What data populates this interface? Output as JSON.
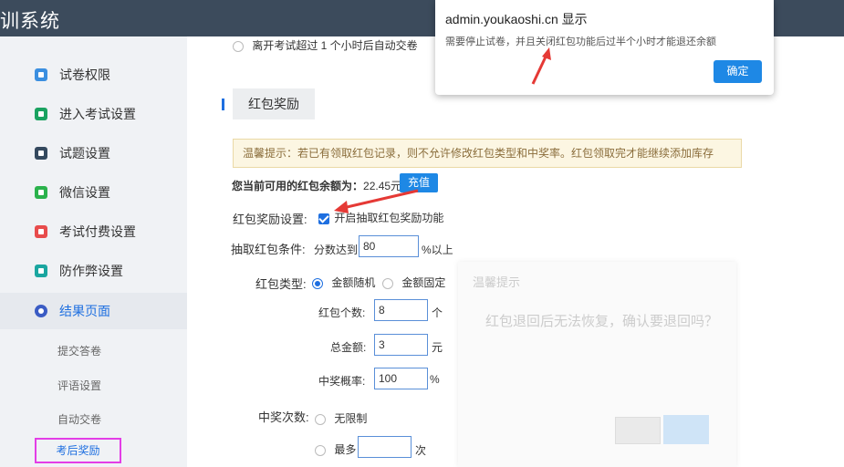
{
  "app": {
    "title": "训系统"
  },
  "sidebar": {
    "items": [
      {
        "label": "试卷权限",
        "icon": "shield-doc-icon",
        "color": "#3b8fe0"
      },
      {
        "label": "进入考试设置",
        "icon": "enter-doc-icon",
        "color": "#1aa260"
      },
      {
        "label": "试题设置",
        "icon": "list-icon",
        "color": "#34495e"
      },
      {
        "label": "微信设置",
        "icon": "wechat-icon",
        "color": "#2bb24c"
      },
      {
        "label": "考试付费设置",
        "icon": "payment-icon",
        "color": "#e84c4c"
      },
      {
        "label": "防作弊设置",
        "icon": "shield-icon",
        "color": "#1aa6a0"
      },
      {
        "label": "结果页面",
        "icon": "eye-icon",
        "color": "#3b5cc4"
      }
    ],
    "subitems": [
      {
        "label": "提交答卷"
      },
      {
        "label": "评语设置"
      },
      {
        "label": "自动交卷"
      },
      {
        "label": "考后奖励"
      }
    ]
  },
  "content": {
    "auto_submit_option": "离开考试超过 1 个小时后自动交卷",
    "section_title": "红包奖励",
    "notice": "温馨提示：若已有领取红包记录，则不允许修改红包类型和中奖率。红包领取完才能继续添加库存",
    "balance_label": "您当前可用的红包余额为：",
    "balance_value": "22.45元",
    "recharge_button": "充值",
    "reward_setting_label": "红包奖励设置:",
    "reward_enable_label": "开启抽取红包奖励功能",
    "condition_label": "抽取红包条件:",
    "condition_prefix": "分数达到",
    "condition_value": "80",
    "condition_suffix": "%以上",
    "type_label": "红包类型:",
    "type_random": "金额随机",
    "type_fixed": "金额固定",
    "count_label": "红包个数:",
    "count_value": "8",
    "count_unit": "个",
    "amount_label": "总金额:",
    "amount_value": "3",
    "amount_unit": "元",
    "rate_label": "中奖概率:",
    "rate_value": "100",
    "rate_unit": "%",
    "times_label": "中奖次数:",
    "times_unlimited": "无限制",
    "times_max": "最多",
    "times_value": "",
    "times_unit": "次"
  },
  "ghost_dialog": {
    "title": "温馨提示",
    "message": "红包退回后无法恢复，确认要退回吗？"
  },
  "alert": {
    "origin": "admin.youkaoshi.cn 显示",
    "message": "需要停止试卷，并且关闭红包功能后过半个小时才能退还余额",
    "ok_button": "确定"
  },
  "colors": {
    "accent": "#1e88e5",
    "arrow": "#e53935",
    "highlight": "#e33ee6"
  }
}
